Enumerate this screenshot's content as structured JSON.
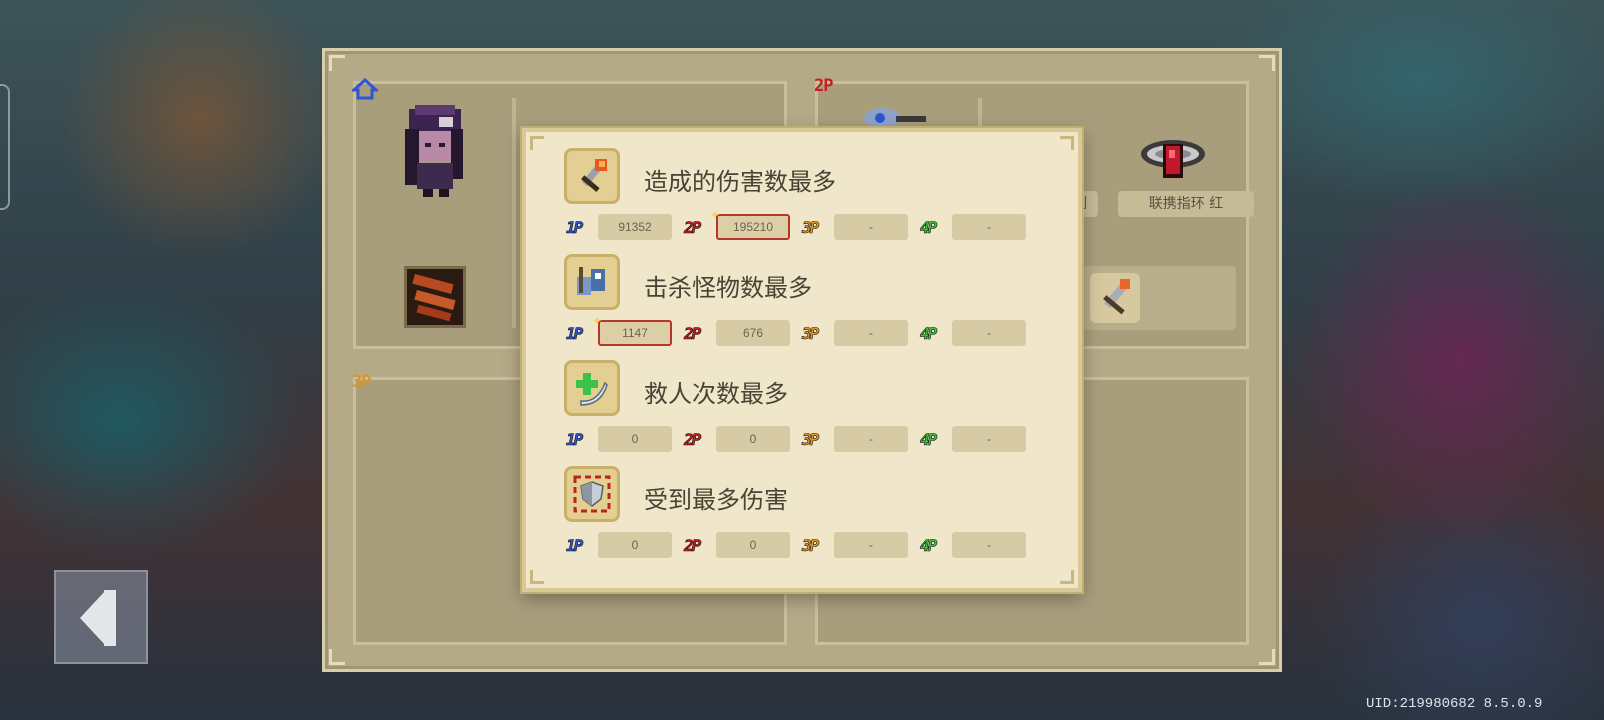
{
  "board": {
    "slot_tags": {
      "p2": "2P",
      "p3": "3P"
    },
    "items": {
      "weapon_partial": "剑",
      "ring": "联携指环 红"
    }
  },
  "dialog": {
    "stats": [
      {
        "title": "造成的伤害数最多",
        "icon": "flaming-sword-icon",
        "players": [
          {
            "badge": "1P",
            "value": "91352",
            "top": false
          },
          {
            "badge": "2P",
            "value": "195210",
            "top": true
          },
          {
            "badge": "3P",
            "value": "-",
            "top": false
          },
          {
            "badge": "4P",
            "value": "-",
            "top": false
          }
        ]
      },
      {
        "title": "击杀怪物数最多",
        "icon": "monster-kill-icon",
        "players": [
          {
            "badge": "1P",
            "value": "1147",
            "top": true
          },
          {
            "badge": "2P",
            "value": "676",
            "top": false
          },
          {
            "badge": "3P",
            "value": "-",
            "top": false
          },
          {
            "badge": "4P",
            "value": "-",
            "top": false
          }
        ]
      },
      {
        "title": "救人次数最多",
        "icon": "revive-icon",
        "players": [
          {
            "badge": "1P",
            "value": "0",
            "top": false
          },
          {
            "badge": "2P",
            "value": "0",
            "top": false
          },
          {
            "badge": "3P",
            "value": "-",
            "top": false
          },
          {
            "badge": "4P",
            "value": "-",
            "top": false
          }
        ]
      },
      {
        "title": "受到最多伤害",
        "icon": "shield-damage-icon",
        "players": [
          {
            "badge": "1P",
            "value": "0",
            "top": false
          },
          {
            "badge": "2P",
            "value": "0",
            "top": false
          },
          {
            "badge": "3P",
            "value": "-",
            "top": false
          },
          {
            "badge": "4P",
            "value": "-",
            "top": false
          }
        ]
      }
    ]
  },
  "colors": {
    "p1": "#2f55d6",
    "p2": "#c81e1e",
    "p3": "#f09a1a",
    "p4": "#3fc23c",
    "highlight_border": "#b6362d"
  },
  "footer": {
    "uid": "UID:219980682 8.5.0.9"
  }
}
